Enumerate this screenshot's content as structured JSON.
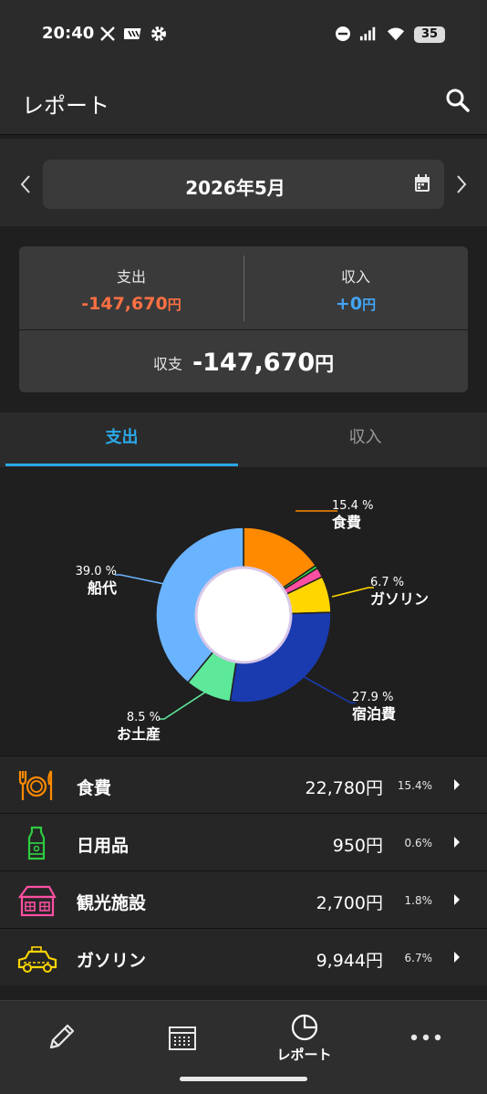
{
  "status": {
    "time": "20:40",
    "battery": "35"
  },
  "header": {
    "title": "レポート"
  },
  "month": {
    "label": "2026年5月"
  },
  "summary": {
    "expense_label": "支出",
    "expense_value": "-147,670",
    "income_label": "収入",
    "income_value": "+0",
    "yen": "円",
    "balance_label": "収支",
    "balance_value": "-147,670"
  },
  "tabs": [
    {
      "label": "支出",
      "active": true
    },
    {
      "label": "収入",
      "active": false
    }
  ],
  "chart_data": {
    "type": "pie",
    "title": "",
    "slices": [
      {
        "label": "食費",
        "value": 15.4,
        "pct_label": "15.4 %",
        "color": "#ff8a00"
      },
      {
        "label": "日用品",
        "value": 0.6,
        "pct_label": "",
        "color": "#2ecc40"
      },
      {
        "label": "観光施設",
        "value": 1.8,
        "pct_label": "",
        "color": "#ff4fa3"
      },
      {
        "label": "ガソリン",
        "value": 6.7,
        "pct_label": "6.7 %",
        "color": "#ffd600"
      },
      {
        "label": "宿泊費",
        "value": 27.9,
        "pct_label": "27.9 %",
        "color": "#1a3bb0"
      },
      {
        "label": "お土産",
        "value": 8.5,
        "pct_label": "8.5 %",
        "color": "#5ee89a"
      },
      {
        "label": "船代",
        "value": 39.0,
        "pct_label": "39.0 %",
        "color": "#6ab4ff"
      }
    ]
  },
  "categories": [
    {
      "name": "食費",
      "amount": "22,780円",
      "pct": "15.4%",
      "icon": "utensils-icon",
      "color": "#ff8a00"
    },
    {
      "name": "日用品",
      "amount": "950円",
      "pct": "0.6%",
      "icon": "bottle-icon",
      "color": "#2ecc40"
    },
    {
      "name": "観光施設",
      "amount": "2,700円",
      "pct": "1.8%",
      "icon": "house-icon",
      "color": "#ff4fa3"
    },
    {
      "name": "ガソリン",
      "amount": "9,944円",
      "pct": "6.7%",
      "icon": "car-icon",
      "color": "#ffd600"
    }
  ],
  "nav": {
    "report_label": "レポート"
  },
  "colors": {
    "expense": "#ff7043",
    "income": "#42a5f5",
    "tab_accent": "#2aa8e8"
  }
}
